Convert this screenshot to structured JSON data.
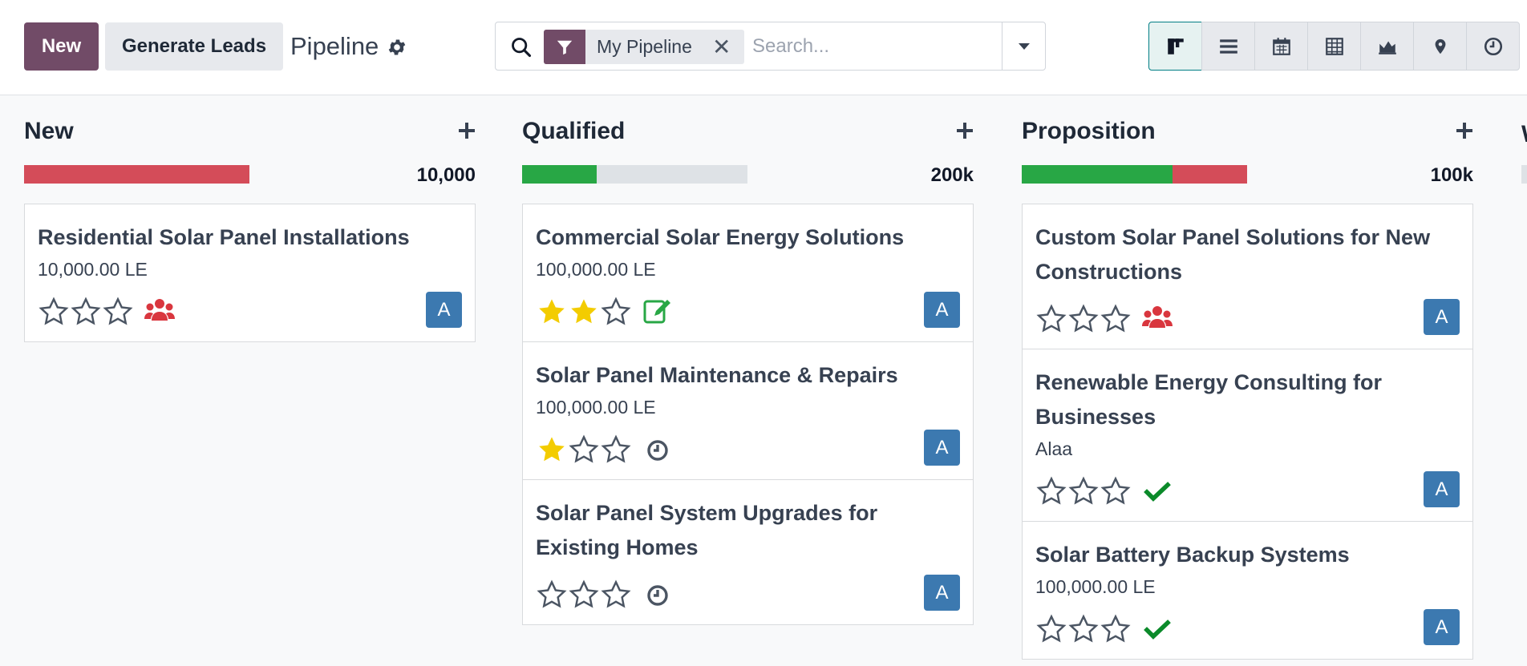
{
  "control_panel": {
    "new_label": "New",
    "generate_leads_label": "Generate Leads",
    "title": "Pipeline",
    "search": {
      "facet_label": "My Pipeline",
      "facet_close": "✕",
      "placeholder": "Search..."
    },
    "views": [
      {
        "name": "kanban",
        "icon": "kanban-icon",
        "active": true
      },
      {
        "name": "list",
        "icon": "list-icon"
      },
      {
        "name": "calendar",
        "icon": "calendar-icon"
      },
      {
        "name": "pivot",
        "icon": "pivot-table-icon"
      },
      {
        "name": "graph",
        "icon": "area-chart-icon"
      },
      {
        "name": "map",
        "icon": "map-marker-icon"
      },
      {
        "name": "activity",
        "icon": "clock-icon"
      }
    ]
  },
  "colors": {
    "brand": "#714b67",
    "progress_green": "#28a745",
    "progress_red": "#d44c59",
    "avatar_blue": "#3c79b0",
    "star_yellow": "#f3cc00"
  },
  "columns": [
    {
      "title": "New",
      "total": "10,000",
      "progress": {
        "green": 0,
        "red": 1.0
      },
      "cards": [
        {
          "title": "Residential Solar Panel Installations",
          "subtitle": "10,000.00 LE",
          "stars": 0,
          "activity": "users-icon",
          "avatar": "A"
        }
      ]
    },
    {
      "title": "Qualified",
      "total": "200k",
      "progress": {
        "green": 0.33,
        "red": 0
      },
      "cards": [
        {
          "title": "Commercial Solar Energy Solutions",
          "subtitle": "100,000.00 LE",
          "stars": 2,
          "activity": "edit-icon",
          "avatar": "A"
        },
        {
          "title": "Solar Panel Maintenance & Repairs",
          "subtitle": "100,000.00 LE",
          "stars": 1,
          "activity": "clock-icon",
          "avatar": "A"
        },
        {
          "title": "Solar Panel System Upgrades for Existing Homes",
          "subtitle": "",
          "stars": 0,
          "activity": "clock-icon",
          "avatar": "A"
        }
      ]
    },
    {
      "title": "Proposition",
      "total": "100k",
      "progress": {
        "green": 0.67,
        "red": 0.33
      },
      "cards": [
        {
          "title": "Custom Solar Panel Solutions for New Constructions",
          "subtitle": "",
          "stars": 0,
          "activity": "users-icon",
          "avatar": "A"
        },
        {
          "title": "Renewable Energy Consulting for Businesses",
          "subtitle": "Alaa",
          "stars": 0,
          "activity": "check-icon",
          "avatar": "A"
        },
        {
          "title": "Solar Battery Backup Systems",
          "subtitle": "100,000.00 LE",
          "stars": 0,
          "activity": "check-icon",
          "avatar": "A"
        }
      ]
    }
  ],
  "next_column_peek": "W"
}
